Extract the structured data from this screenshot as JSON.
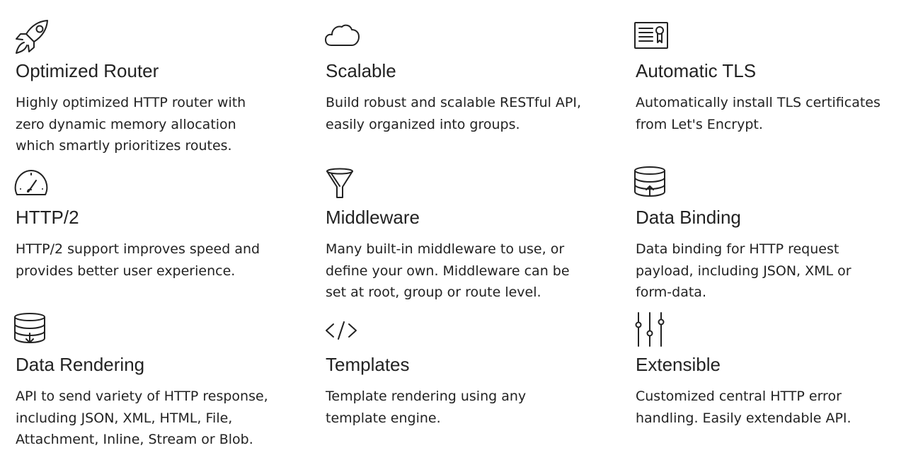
{
  "features": [
    {
      "icon": "rocket-icon",
      "title": "Optimized Router",
      "lines": [
        "Highly optimized HTTP router with",
        "zero dynamic memory allocation",
        "which smartly prioritizes routes."
      ]
    },
    {
      "icon": "cloud-icon",
      "title": "Scalable",
      "lines": [
        "Build robust and scalable RESTful API,",
        "easily organized into groups."
      ]
    },
    {
      "icon": "certificate-icon",
      "title": "Automatic TLS",
      "lines": [
        "Automatically install TLS certificates",
        "from Let's Encrypt."
      ]
    },
    {
      "icon": "speedometer-icon",
      "title": "HTTP/2",
      "lines": [
        "HTTP/2 support improves speed and",
        "provides better user experience."
      ]
    },
    {
      "icon": "funnel-icon",
      "title": "Middleware",
      "lines": [
        "Many built-in middleware to use, or",
        "define your own. Middleware can be",
        "set at root, group or route level."
      ]
    },
    {
      "icon": "database-upload-icon",
      "title": "Data Binding",
      "lines": [
        "Data binding for HTTP request",
        "payload, including JSON, XML or",
        "form-data."
      ]
    },
    {
      "icon": "database-download-icon",
      "title": "Data Rendering",
      "lines": [
        "API to send variety of HTTP response,",
        "including JSON, XML, HTML, File,",
        "Attachment, Inline, Stream or Blob."
      ]
    },
    {
      "icon": "code-icon",
      "title": "Templates",
      "lines": [
        "Template rendering using any",
        "template engine."
      ]
    },
    {
      "icon": "sliders-icon",
      "title": "Extensible",
      "lines": [
        "Customized central HTTP error",
        "handling. Easily extendable API."
      ]
    }
  ]
}
